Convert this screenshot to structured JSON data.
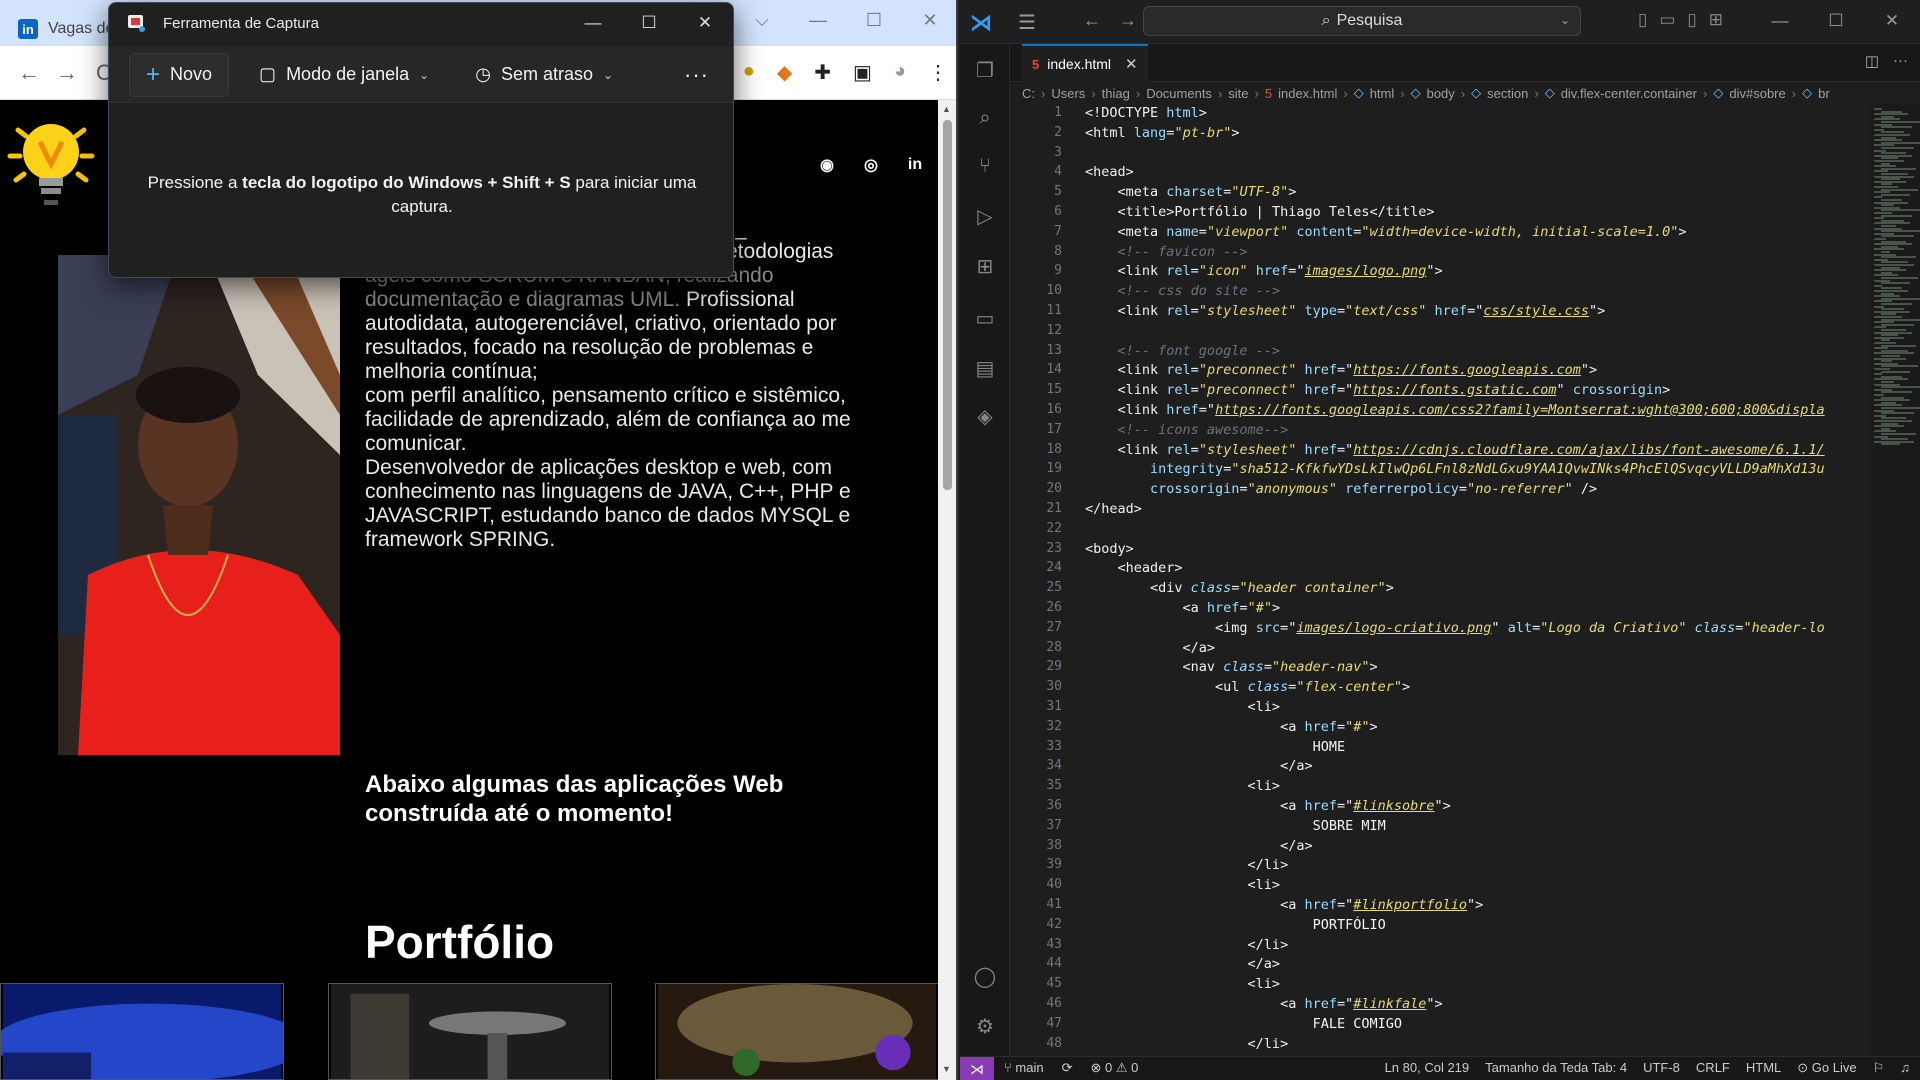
{
  "browser": {
    "tab_title": "Vagas de",
    "page": {
      "about_lines_dim": [
        "ágeis como SCRUM e KANBAN, realizando",
        "documentação e diagramas UML."
      ],
      "about_line_mid": " Profissional",
      "about_lines": [
        "autodidata, autogerenciável, criativo, orientado por",
        "resultados, focado na resolução de problemas e",
        "melhoria contínua;",
        "com perfil analítico, pensamento crítico e sistêmico,",
        "facilidade de aprendizado, além de confiança ao me",
        "comunicar.",
        "Desenvolvedor de aplicações desktop e web, com",
        "conhecimento nas linguagens de JAVA, C++, PHP e",
        "JAVASCRIPT, estudando banco de dados MYSQL e",
        "framework SPRING."
      ],
      "about_tail_1": "etodologias",
      "subtitle": "Abaixo algumas das aplicações Web construída até o momento!",
      "portfolio_title": "Portfólio"
    }
  },
  "snipping_tool": {
    "title": "Ferramenta de Captura",
    "new_label": "Novo",
    "mode_label": "Modo de janela",
    "delay_label": "Sem atraso",
    "more_label": "···",
    "message_part1": "Pressione a ",
    "message_bold": "tecla do logotipo do Windows + Shift + S",
    "message_part2": " para iniciar uma captura."
  },
  "vscode": {
    "search_label": "Pesquisa",
    "tab_label": "index.html",
    "breadcrumbs": [
      "C:",
      "Users",
      "thiag",
      "Documents",
      "site",
      "index.html",
      "html",
      "body",
      "section",
      "div.flex-center.container",
      "div#sobre",
      "br"
    ],
    "status": {
      "branch": "main",
      "problems": "⊗ 0 ⚠ 0",
      "position": "Ln 80, Col 219",
      "tab_size": "Tamanho da Teda Tab: 4",
      "encoding": "UTF-8",
      "eol": "CRLF",
      "language": "HTML",
      "golive": "Go Live"
    },
    "colors": {
      "accent": "#0078d4",
      "remote": "#8a3bb3"
    }
  }
}
